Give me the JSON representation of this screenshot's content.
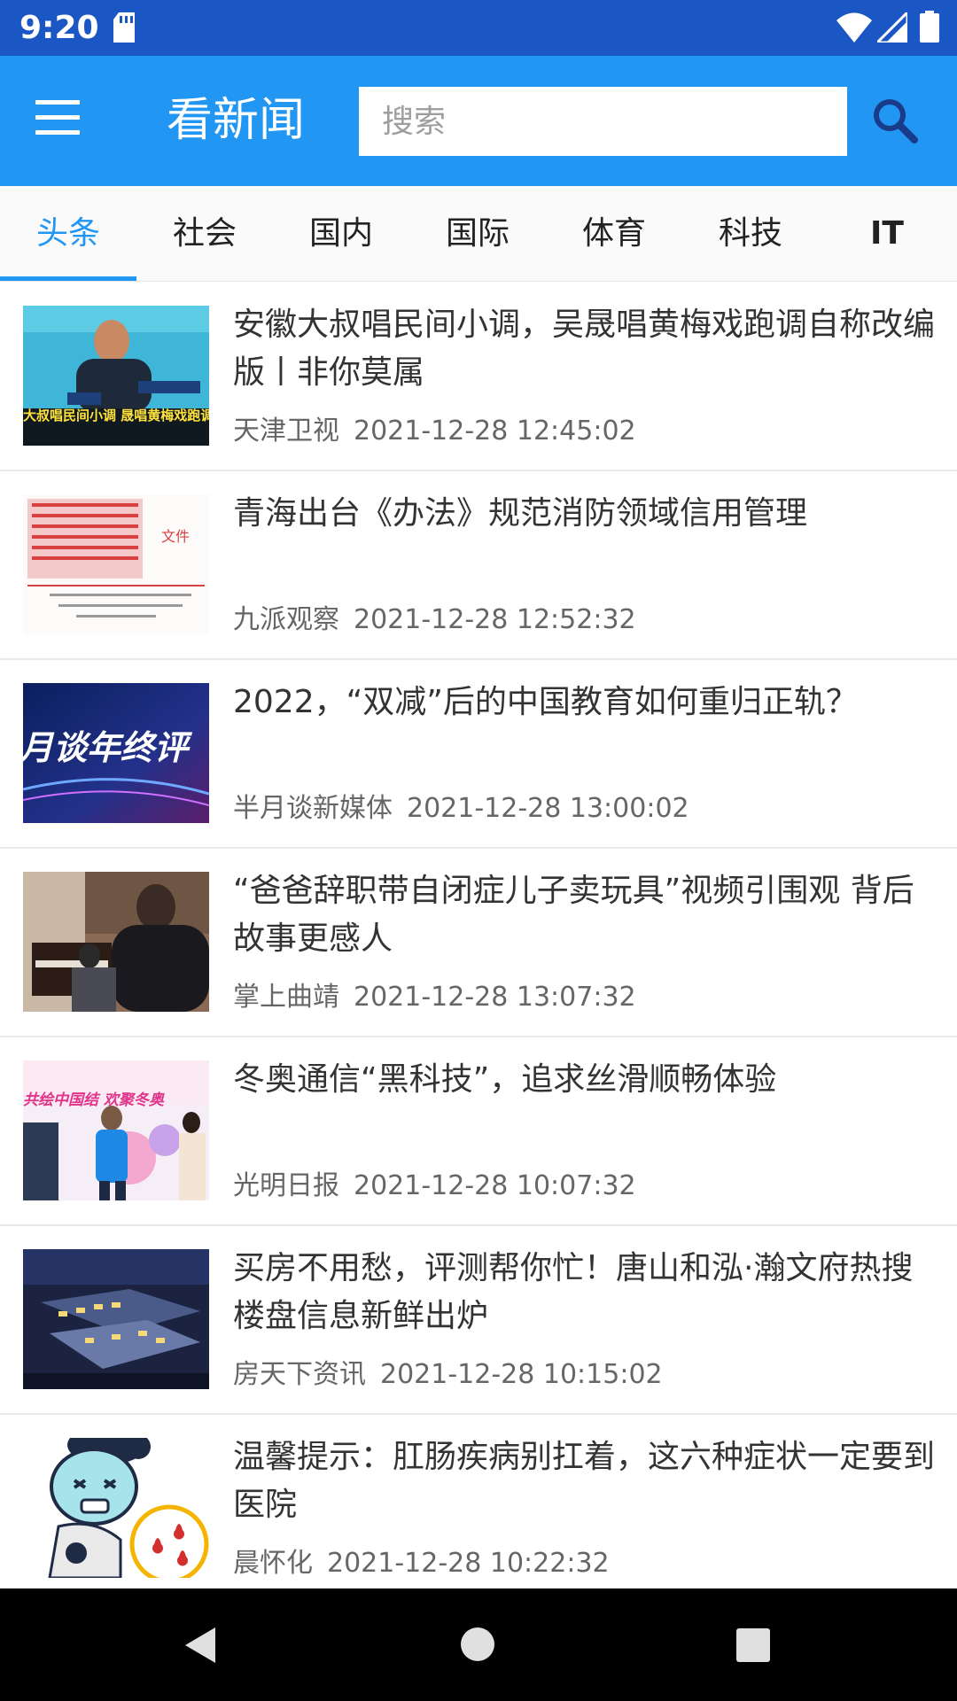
{
  "status_bar": {
    "time": "9:20",
    "icons": [
      "sd-card-icon",
      "wifi-icon",
      "signal-icon",
      "battery-icon"
    ]
  },
  "app_bar": {
    "title": "看新闻",
    "search_placeholder": "搜索",
    "menu_icon": "menu-icon",
    "search_icon": "search-icon",
    "color": "#2196f3"
  },
  "tabs": [
    {
      "label": "头条",
      "active": true
    },
    {
      "label": "社会",
      "active": false
    },
    {
      "label": "国内",
      "active": false
    },
    {
      "label": "国际",
      "active": false
    },
    {
      "label": "体育",
      "active": false
    },
    {
      "label": "科技",
      "active": false
    },
    {
      "label": "IT",
      "active": false
    }
  ],
  "news": [
    {
      "title": "安徽大叔唱民间小调，吴晟唱黄梅戏跑调自称改编版丨非你莫属",
      "source": "天津卫视",
      "date": "2021-12-28 12:45:02",
      "thumb_text": "大叔唱民间小调 晟唱黄梅戏跑调自称改编"
    },
    {
      "title": "青海出台《办法》规范消防领域信用管理",
      "source": "九派观察",
      "date": "2021-12-28 12:52:32",
      "thumb_text": "文件"
    },
    {
      "title": "2022，“双减”后的中国教育如何重归正轨？",
      "source": "半月谈新媒体",
      "date": "2021-12-28 13:00:02",
      "thumb_text": "月谈年终评"
    },
    {
      "title": "“爸爸辞职带自闭症儿子卖玩具”视频引围观 背后故事更感人",
      "source": "掌上曲靖",
      "date": "2021-12-28 13:07:32",
      "thumb_text": ""
    },
    {
      "title": "冬奥通信“黑科技”，追求丝滑顺畅体验",
      "source": "光明日报",
      "date": "2021-12-28 10:07:32",
      "thumb_text": "共绘中国结 欢聚冬奥"
    },
    {
      "title": "买房不用愁，评测帮你忙！唐山和泓·瀚文府热搜楼盘信息新鲜出炉",
      "source": "房天下资讯",
      "date": "2021-12-28 10:15:02",
      "thumb_text": ""
    },
    {
      "title": "温馨提示：肛肠疾病别扛着，这六种症状一定要到医院",
      "source": "晨怀化",
      "date": "2021-12-28 10:22:32",
      "thumb_text": ""
    }
  ],
  "nav_bar": {
    "icons": [
      "back-icon",
      "home-icon",
      "recents-icon"
    ]
  }
}
